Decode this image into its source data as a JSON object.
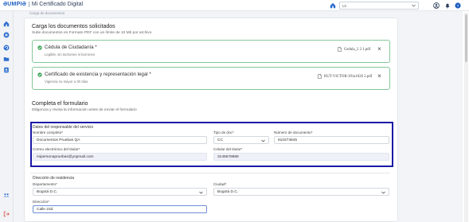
{
  "app": {
    "brand": "ƏUMPIƏ",
    "title": "Mi Certificado Digital",
    "user_select": "Lit"
  },
  "breadcrumb": "Carga de documentos",
  "uploads": {
    "title": "Carga los documentos solicitados",
    "subtitle": "Sube documentos en Formato PDF con un límite de 10 Mb por archivo",
    "docs": [
      {
        "title": "Cédula de Ciudadanía *",
        "hint": "Legible, sin tachones ni borrones",
        "file": "Cedula_2 2 1.pdf"
      },
      {
        "title": "Certificado de existencia y representación legal *",
        "hint": "Vigencia no mayor a 30 días",
        "file": "RUT-VICTOR-391a1826 2.pdf"
      }
    ]
  },
  "form": {
    "title": "Completa el formulario",
    "subtitle": "Diligencia y revisa la información antes de enviar el formulario",
    "responsable": {
      "title": "Datos del responsable del servicio",
      "nombre_label": "Nombre completo*",
      "nombre_value": "Documentos Pruebas QA",
      "tipo_label": "Tipo de doc*",
      "tipo_value": "CC",
      "numero_label": "Número de documento*",
      "numero_value": "910273645",
      "correo_label": "Correo electrónico del titular*",
      "correo_value": "mipersonapruebas@yopmail.com",
      "celular_label": "Celular del titular*",
      "celular_value": "3145678888"
    },
    "residencia": {
      "title": "Dirección de residencia",
      "departamento_label": "Departamento*",
      "departamento_value": "Bogotá D.C.",
      "ciudad_label": "Ciudad*",
      "ciudad_value": "Bogotá D.C.",
      "direccion_label": "Dirección*",
      "direccion_value": "Calle 23d"
    }
  },
  "colors": {
    "brand_blue": "#1f5fbf",
    "success_green": "#86c79a",
    "highlight_border": "#1a1aa6"
  }
}
